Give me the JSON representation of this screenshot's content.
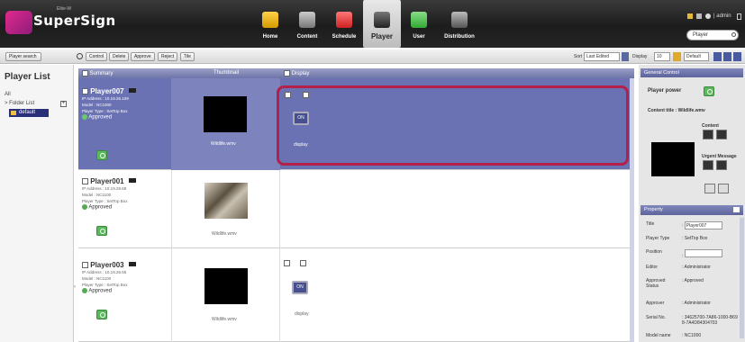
{
  "app": {
    "logo_text": "SuperSign",
    "logo_sub": "Elite-W",
    "nav": [
      "Home",
      "Content",
      "Schedule",
      "Player",
      "User",
      "Distribution"
    ],
    "nav_active": "Player",
    "top_user": "| admin",
    "search_value": "Player"
  },
  "toolbar": {
    "player_search": "Player search",
    "buttons": [
      "Control",
      "Delete",
      "Approve",
      "Reject",
      "Tile"
    ],
    "sort_label": "Sort",
    "sort_value": "Last Edited",
    "display_label": "Display",
    "display_count": "10",
    "display_mode": "Default"
  },
  "left": {
    "title": "Player List",
    "all": "All",
    "folder_list": "> Folder List",
    "folder_default": "default"
  },
  "grid": {
    "headers": [
      "Summary",
      "Thumbnail",
      "Display"
    ],
    "rows": [
      {
        "name": "Player007",
        "ip": "IP Address : 10.19.26.109",
        "model": "Model : NC1000",
        "type": "Player Type : SetTop Box",
        "status": "Approved",
        "thumb_caption": "Wildlife.wmv",
        "on_label": "ON",
        "display_caption": "display"
      },
      {
        "name": "Player001",
        "ip": "IP Address : 10.19.26.69",
        "model": "Model : NC1100",
        "type": "Player Type : SetTop Box",
        "status": "Approved",
        "thumb_caption": "Wildlife.wmv"
      },
      {
        "name": "Player003",
        "ip": "IP Address : 10.19.26.65",
        "model": "Model : NC1100",
        "type": "Player Type : SetTop Box",
        "status": "Approved",
        "thumb_caption": "Wildlife.wmv",
        "on_label": "ON",
        "display_caption": "display"
      }
    ]
  },
  "general_control": {
    "title": "General Control",
    "player_power": "Player power",
    "content_title": "Content title : Wildlife.wmv",
    "content_label": "Content",
    "urgent_label": "Urgent Message"
  },
  "property": {
    "title": "Property",
    "rows": [
      {
        "label": "Title",
        "value": "Player007"
      },
      {
        "label": "Player Type",
        "value": "SetTop Box"
      },
      {
        "label": "Position",
        "value": ""
      },
      {
        "label": "Editor",
        "value": "Administrator"
      },
      {
        "label": "Approved Status",
        "value": "Approved"
      },
      {
        "label": "Approver",
        "value": "Administrator"
      },
      {
        "label": "Serial No.",
        "value": "34625700-7A86-1000-B698-7A4D84304703"
      },
      {
        "label": "Model name",
        "value": "NC1000"
      }
    ]
  },
  "colors": {
    "selected_row": "#6b72b3",
    "highlight_border": "#b3204a",
    "header_bar": "#262626",
    "approved_green": "#5cb85c"
  }
}
